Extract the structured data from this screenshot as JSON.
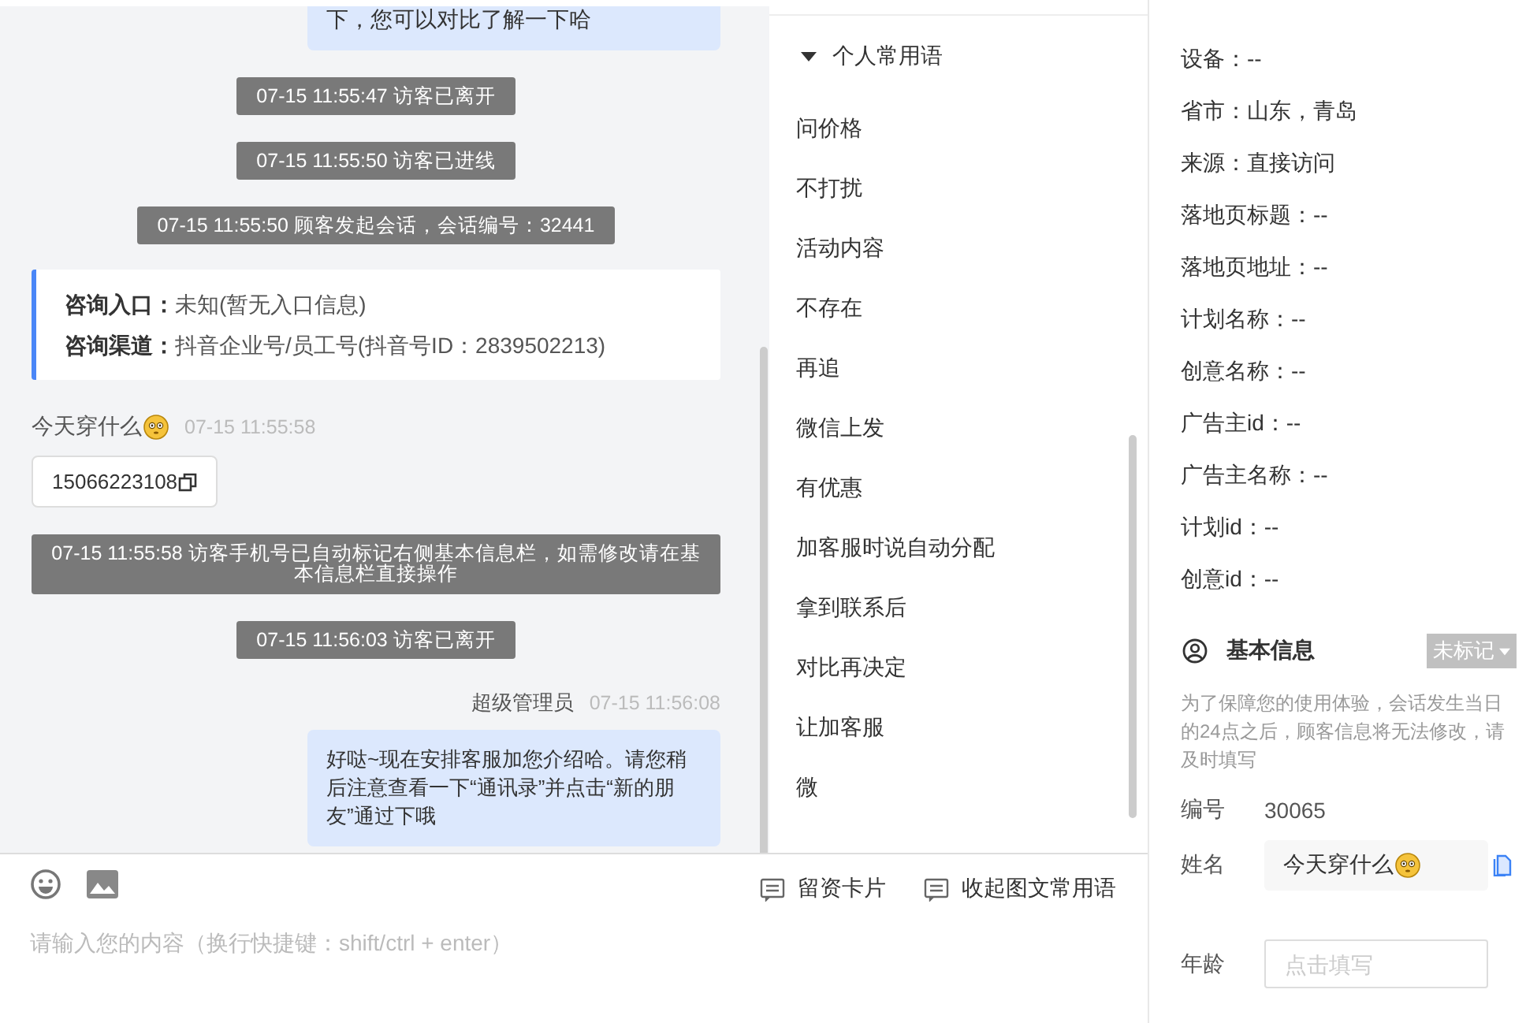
{
  "chat": {
    "messages": [
      {
        "kind": "agent_text",
        "text": "下，您可以对比了解一下哈"
      },
      {
        "kind": "system",
        "text": "07-15 11:55:47 访客已离开"
      },
      {
        "kind": "system",
        "text": "07-15 11:55:50 访客已进线"
      },
      {
        "kind": "system",
        "text": "07-15 11:55:50 顾客发起会话，会话编号：32441"
      },
      {
        "kind": "entry_card",
        "rows": [
          {
            "label": "咨询入口：",
            "value": "未知(暂无入口信息)"
          },
          {
            "label": "咨询渠道：",
            "value": "抖音企业号/员工号(抖音号ID：2839502213)"
          }
        ]
      },
      {
        "kind": "visitor_header",
        "name": "今天穿什么",
        "time": "07-15 11:55:58"
      },
      {
        "kind": "phone_card",
        "text": "15066223108"
      },
      {
        "kind": "system",
        "text": "07-15 11:55:58 访客手机号已自动标记右侧基本信息栏，如需修改请在基本信息栏直接操作"
      },
      {
        "kind": "system",
        "text": "07-15 11:56:03 访客已离开"
      },
      {
        "kind": "agent_header",
        "name": "超级管理员",
        "time": "07-15 11:56:08"
      },
      {
        "kind": "agent_text",
        "text": "好哒~现在安排客服加您介绍哈。请您稍后注意查看一下“通讯录”并点击“新的朋友”通过下哦"
      }
    ]
  },
  "composer": {
    "buttons": [
      "留资卡片",
      "收起图文常用语"
    ],
    "placeholder": "请输入您的内容（换行快捷键：shift/ctrl + enter）"
  },
  "phrases": {
    "group": {
      "label": "个人常用语",
      "expanded": true
    },
    "items": [
      "问价格",
      "不打扰",
      "活动内容",
      "不存在",
      "再追",
      "微信上发",
      "有优惠",
      "加客服时说自动分配",
      "拿到联系后",
      "对比再决定",
      "让加客服",
      "微"
    ]
  },
  "source_info": {
    "rows": [
      "设备：--",
      "省市：山东，青岛",
      "来源：直接访问",
      "落地页标题：--",
      "落地页地址：--",
      "计划名称：--",
      "创意名称：--",
      "广告主id：--",
      "广告主名称：--",
      "计划id：--",
      "创意id：--"
    ]
  },
  "basic_info": {
    "title": "基本信息",
    "tag": "未标记",
    "notice": "为了保障您的使用体验，会话发生当日的24点之后，顾客信息将无法修改，请及时填写",
    "fields": [
      {
        "kind": "text",
        "label": "编号",
        "value": "30065"
      },
      {
        "kind": "name",
        "label": "姓名",
        "value": "今天穿什么"
      },
      {
        "kind": "input",
        "label": "年龄",
        "placeholder": "点击填写"
      }
    ]
  }
}
